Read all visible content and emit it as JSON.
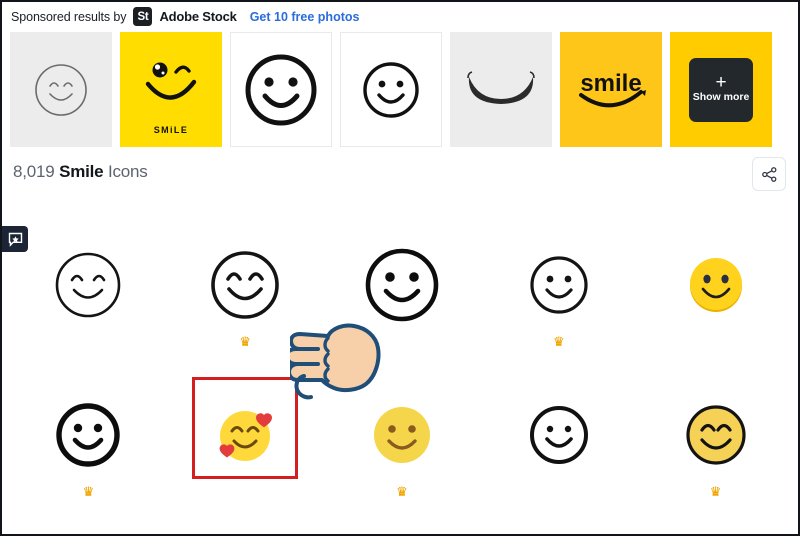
{
  "sponsored": {
    "label": "Sponsored results by",
    "logo_text": "St",
    "brand": "Adobe Stock",
    "cta": "Get 10 free photos",
    "thumbnails": [
      {
        "name": "thin-outline-smiley",
        "style": "grey",
        "caption": ""
      },
      {
        "name": "winking-smiley-yellow",
        "style": "yellow",
        "caption": "SMiLE"
      },
      {
        "name": "bold-outline-smiley",
        "style": "white",
        "caption": ""
      },
      {
        "name": "outline-smiley-small",
        "style": "white",
        "caption": ""
      },
      {
        "name": "smile-mouth-curve",
        "style": "grey",
        "caption": ""
      },
      {
        "name": "smile-wordmark-logo",
        "style": "amber",
        "caption": "smile"
      },
      {
        "name": "show-more-tile",
        "style": "amber2",
        "caption": "Show more",
        "plus": "+"
      }
    ]
  },
  "results": {
    "count": "8,019",
    "keyword": "Smile",
    "suffix": "Icons",
    "share_icon": "share-icon"
  },
  "feedback": {
    "icon": "feedback-chat-icon"
  },
  "grid": {
    "rows": [
      {
        "cells": [
          {
            "name": "icon-thin-smiley-eyes-closed",
            "premium": false,
            "selected": false,
            "crown": "♛"
          },
          {
            "name": "icon-outline-smiley-happy-eyes",
            "premium": true,
            "selected": false,
            "crown": "♛"
          },
          {
            "name": "icon-bold-smiley-dot-eyes",
            "premium": false,
            "selected": false,
            "crown": "♛"
          },
          {
            "name": "icon-outline-smiley-medium",
            "premium": true,
            "selected": false,
            "crown": "♛"
          },
          {
            "name": "icon-flat-yellow-smiley-3d",
            "premium": false,
            "selected": false,
            "crown": "♛"
          }
        ]
      },
      {
        "cells": [
          {
            "name": "icon-bold-outline-smiley",
            "premium": true,
            "selected": false,
            "crown": "♛"
          },
          {
            "name": "icon-smiling-face-with-hearts",
            "premium": false,
            "selected": true,
            "crown": "♛"
          },
          {
            "name": "icon-flat-yellow-smiley-brown",
            "premium": true,
            "selected": false,
            "crown": "♛"
          },
          {
            "name": "icon-outline-smiley-thin-round",
            "premium": false,
            "selected": false,
            "crown": "♛"
          },
          {
            "name": "icon-yellow-smiley-closed-eyes",
            "premium": true,
            "selected": false,
            "crown": "♛"
          }
        ]
      }
    ]
  },
  "cursor": {
    "name": "pointing-hand-cursor"
  },
  "colors": {
    "accent_yellow": "#ffdd00",
    "amber": "#ffc61a",
    "link_blue": "#2a6ddb",
    "selection_red": "#d31f1f",
    "crown_gold": "#f0a500",
    "dark": "#1b1f24"
  }
}
